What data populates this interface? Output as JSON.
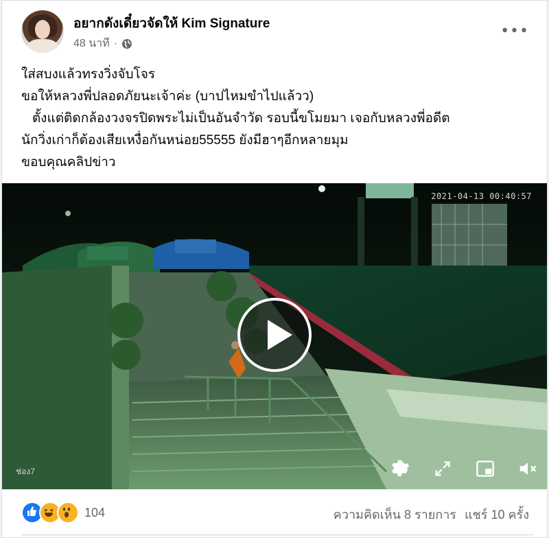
{
  "post": {
    "page_name": "อยากดังเดี๋ยวจัดให้ Kim Signature",
    "time": "48 นาที",
    "separator": "·",
    "text_lines": [
      "ใส่สบงแล้วทรงวิ่งจับโจร",
      "ขอให้หลวงพี่ปลอดภัยนะเจ้าค่ะ (บาปไหมขำไปแล้วว)",
      "   ตั้งแต่ติดกล้องวงจรปิดพระไม่เป็นอันจำวัด รอบนี้ขโมยมา เจอกับหลวงพี่อดีต",
      "นักวิ่งเก่าก็ต้องเสียเหงื่อกันหน่อย55555 ยังมีฮาๆอีกหลายมุม",
      "ขอบคุณคลิปข่าว"
    ]
  },
  "video": {
    "timestamp": "2021-04-13 00:40:57",
    "channel_watermark": "ช่อง7",
    "controls": [
      "gear-icon",
      "expand-icon",
      "pip-icon",
      "mute-icon"
    ]
  },
  "footer": {
    "reaction_count": "104",
    "comments": "ความคิดเห็น 8 รายการ",
    "shares": "แชร์ 10 ครั้ง"
  },
  "colors": {
    "like": "#1877f2",
    "haha": "#f7b125",
    "wow": "#f7b125",
    "secondary_text": "#65676b"
  }
}
